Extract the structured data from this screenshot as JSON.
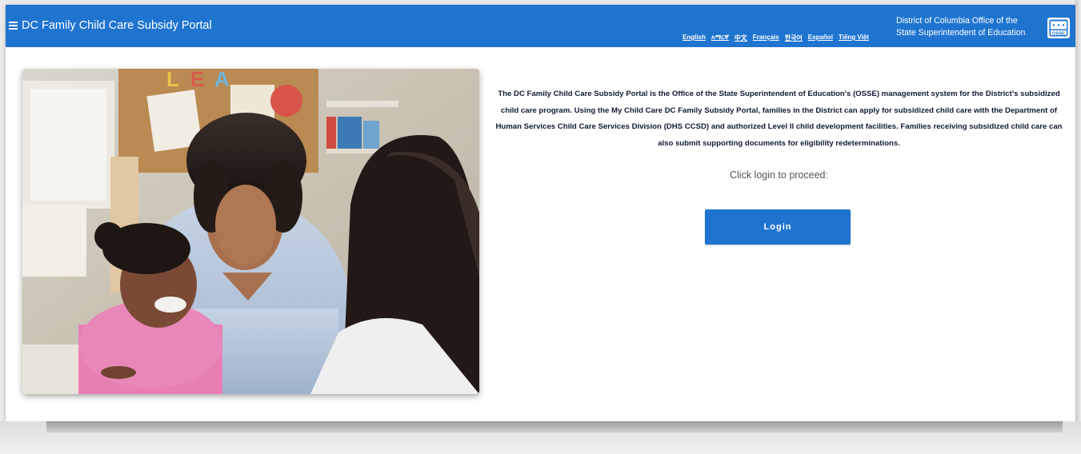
{
  "header": {
    "title": "DC Family Child Care Subsidy Portal",
    "menu_icon": "hamburger-menu-icon",
    "languages": [
      "English",
      "አማርኛ",
      "中文",
      "Français",
      "한국어",
      "Español",
      "Tiếng Việt"
    ],
    "agency_line1": "District of Columbia Office of the",
    "agency_line2": "State Superintendent of Education",
    "logo_text": "OSSE"
  },
  "main": {
    "description": "The DC Family Child Care Subsidy Portal is the Office of the State Superintendent of Education's (OSSE) management system for the District's subsidized child care program. Using the My Child Care DC Family Subsidy Portal, families in the District can apply for subsidized child care with the Department of Human Services Child Care Services Division (DHS CCSD) and authorized Level II child development facilities. Families receiving subsidized child care can also submit supporting documents for eligibility redeterminations.",
    "proceed_text": "Click login to proceed:",
    "login_label": "Login"
  },
  "colors": {
    "brand_blue": "#1f74d0",
    "text_dark": "#101a33"
  }
}
